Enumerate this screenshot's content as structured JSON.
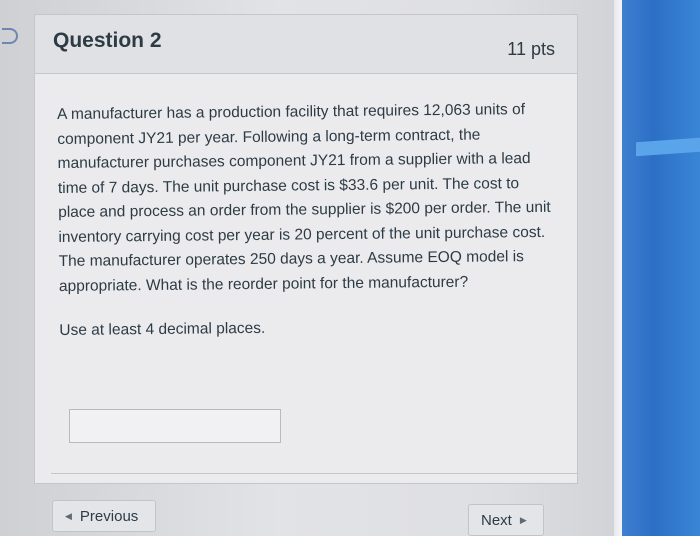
{
  "question": {
    "title": "Question 2",
    "points": "11 pts",
    "body": "A manufacturer has a production facility that requires 12,063 units of component JY21 per year. Following a long-term contract, the manufacturer purchases component JY21 from a supplier with a lead time of 7 days. The unit purchase cost is $33.6 per unit. The cost to place and process an order from the supplier is $200 per order. The unit inventory carrying cost per year is 20 percent of the unit purchase cost. The manufacturer operates 250 days a year. Assume EOQ model is appropriate. What is the reorder point for the manufacturer?",
    "instruction": "Use at least 4 decimal places.",
    "answer_value": ""
  },
  "navigation": {
    "previous_label": "Previous",
    "next_label": "Next"
  },
  "icons": {
    "previous": "chevron-left-icon",
    "next": "chevron-right-icon",
    "question-marker": "question-marker-icon"
  },
  "colors": {
    "text": "#2d3b45",
    "background": "#ebebee",
    "accent_screen": "#2c6fc6"
  }
}
